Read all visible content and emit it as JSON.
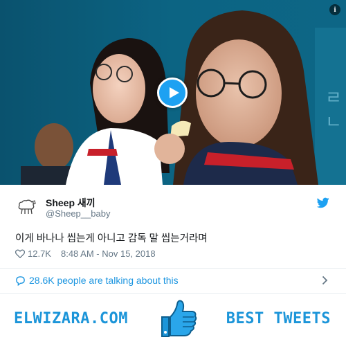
{
  "video": {
    "info_glyph": "i",
    "play_icon": "play-icon"
  },
  "tweet": {
    "user_name": "Sheep 새끼",
    "user_handle": "@Sheep__baby",
    "text": "이게 바나나 씹는게 아니고 감독 말 씹는거라며",
    "likes": "12.7K",
    "timestamp": "8:48 AM - Nov 15, 2018"
  },
  "conversation": {
    "label": "28.6K people are talking about this"
  },
  "banner": {
    "left_text": "ELWIZARA.COM",
    "right_text": "BEST TWEETS"
  },
  "colors": {
    "accent": "#1da1f2",
    "link": "#1b95e0",
    "brand": "#1c95d9",
    "muted": "#657786"
  }
}
